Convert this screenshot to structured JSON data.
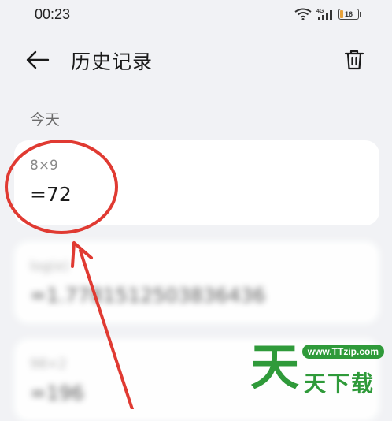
{
  "status_bar": {
    "time": "00:23",
    "network": "4G",
    "battery_level": "16",
    "icons": [
      "wifi-icon",
      "signal-icon",
      "battery-icon"
    ]
  },
  "header": {
    "title": "历史记录",
    "back_icon": "arrow-left-icon",
    "delete_icon": "trash-icon"
  },
  "section": {
    "label": "今天"
  },
  "history": [
    {
      "expression": "8×9",
      "result": "=72"
    },
    {
      "expression": "log(e)",
      "result": "=1.7781512503836436"
    },
    {
      "expression": "98×2",
      "result": "=196"
    }
  ],
  "watermark": {
    "url": "www.TTzip.com",
    "big_char": "天",
    "text": "天下载"
  },
  "colors": {
    "background": "#f1f2f5",
    "card": "#ffffff",
    "annotation": "#e03a32",
    "watermark": "#2f9a3a"
  }
}
